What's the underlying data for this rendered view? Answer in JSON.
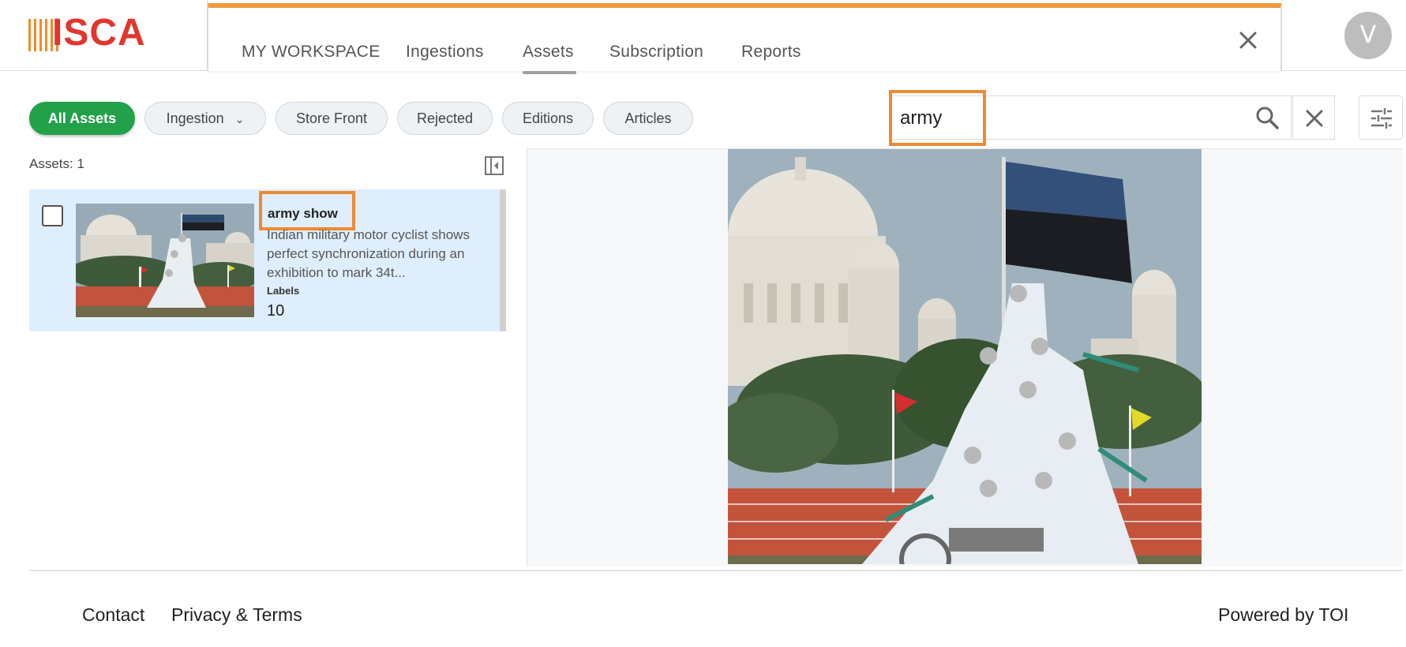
{
  "header": {
    "logo_text": "ISCA",
    "nav": [
      {
        "label": "MY WORKSPACE"
      },
      {
        "label": "Ingestions"
      },
      {
        "label": "Assets"
      },
      {
        "label": "Subscription"
      },
      {
        "label": "Reports"
      }
    ],
    "active_nav": "Assets",
    "avatar_initial": "V"
  },
  "filters": {
    "chips": [
      {
        "label": "All Assets",
        "active": true
      },
      {
        "label": "Ingestion",
        "has_dropdown": true
      },
      {
        "label": "Store Front"
      },
      {
        "label": "Rejected"
      },
      {
        "label": "Editions"
      },
      {
        "label": "Articles"
      }
    ]
  },
  "search": {
    "value": "army",
    "placeholder": ""
  },
  "list": {
    "count_text": "Assets: 1",
    "items": [
      {
        "title": "army show",
        "description": "Indian military motor cyclist shows perfect synchronization during an exhibition to mark 34t...",
        "labels_heading": "Labels",
        "labels_count": "10"
      }
    ]
  },
  "footer": {
    "contact": "Contact",
    "privacy": "Privacy & Terms",
    "powered_by": "Powered by TOI"
  },
  "colors": {
    "accent_orange": "#ef9a3c",
    "brand_red": "#e0362d",
    "active_chip": "#22a04a",
    "selected_row": "#dfeefd"
  }
}
